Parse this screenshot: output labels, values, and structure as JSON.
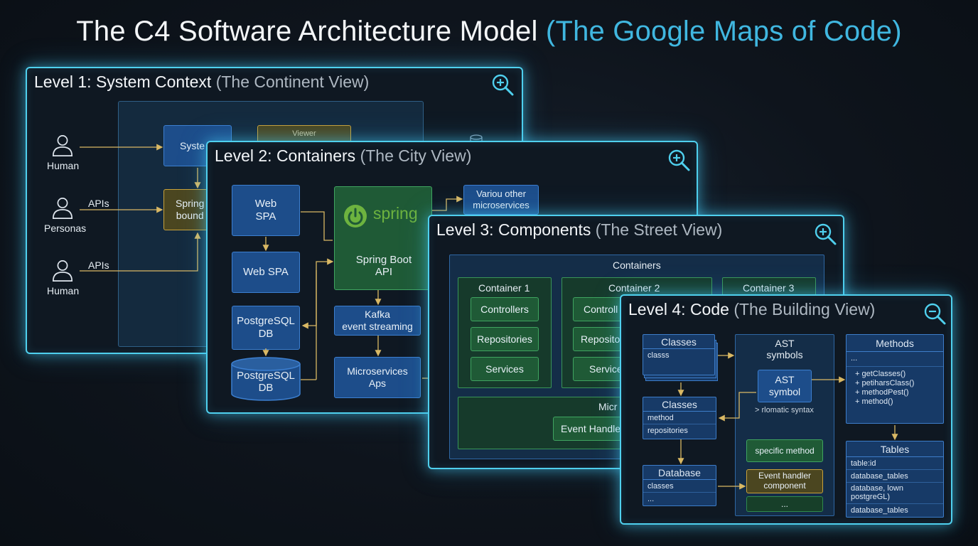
{
  "header": {
    "title_main": "The C4 Software Architecture Model",
    "title_accent": "(The Google Maps of Code)"
  },
  "level1": {
    "title": "Level 1: System Context",
    "subtitle": "(The Continent View)",
    "actors": [
      {
        "label": "Human"
      },
      {
        "label": "Personas"
      },
      {
        "label": "Human"
      }
    ],
    "edge_labels": [
      "APIs",
      "APIs"
    ],
    "boxes": {
      "system": "Syste",
      "spring": "Spring\nbound",
      "viewer": "Viewer"
    },
    "zoom_icon": "zoom-in-icon"
  },
  "level2": {
    "title": "Level 2: Containers",
    "subtitle": "(The City View)",
    "boxes": {
      "web_spa_1": "Web\nSPA",
      "web_spa_2": "Web SPA",
      "postgres_1": "PostgreSQL\nDB",
      "postgres_2": "PostgreSQL\nDB",
      "spring_logo": "spring",
      "spring_boot": "Spring Boot\nAPI",
      "kafka": "Kafka\nevent streaming",
      "microservices": "Microservices\nAps",
      "various": "Variou other\nmicroservices"
    },
    "zoom_icon": "zoom-in-icon"
  },
  "level3": {
    "title": "Level 3: Components",
    "subtitle": "(The Street View)",
    "containers_label": "Containers",
    "container1": {
      "label": "Container 1",
      "items": [
        "Controllers",
        "Repositories",
        "Services"
      ]
    },
    "container2": {
      "label": "Container 2",
      "items": [
        "Controll",
        "Reposito",
        "Service"
      ]
    },
    "container3": {
      "label": "Container 3"
    },
    "micro_label": "Micr",
    "event_handler": "Event Handle",
    "zoom_icon": "zoom-in-icon"
  },
  "level4": {
    "title": "Level 4: Code",
    "subtitle": "(The Building View)",
    "classes_top": {
      "head": "Classes",
      "rows": [
        "classs"
      ]
    },
    "classes_mid": {
      "head": "Classes",
      "rows": [
        "method",
        "repositories"
      ]
    },
    "database": {
      "head": "Database",
      "rows": [
        "classes",
        "..."
      ]
    },
    "ast": {
      "head": "AST\nsymbols",
      "inner": "AST\nsymbol",
      "note": "> rlomatic syntax"
    },
    "specific_method": "specific method",
    "event_handler": "Event handler\ncomponent",
    "ellipsis": "...",
    "methods": {
      "head": "Methods",
      "rows": [
        "...",
        "+ getClasses()",
        "+ petiharsClass()",
        "+ methodPest()",
        "+ method()"
      ]
    },
    "tables": {
      "head": "Tables",
      "rows": [
        "table:id",
        "database_tables",
        "database, lown\npostgreGL)",
        "database_tables"
      ]
    },
    "zoom_icon": "zoom-out-icon"
  },
  "colors": {
    "panel_border": "#4fd0ee",
    "accent": "#40b7e0",
    "blue_box": "#1d4d8a",
    "green_box": "#1f5a36",
    "orange_box": "#4b4620",
    "arrow": "#d9b864"
  }
}
